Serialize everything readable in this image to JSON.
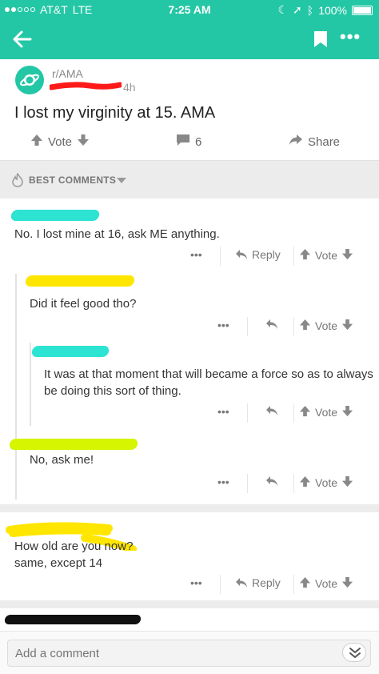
{
  "status_bar": {
    "carrier": "AT&T",
    "network": "LTE",
    "time": "7:25 AM",
    "battery": "100%"
  },
  "app_bar": {
    "back_icon": "arrow-left-icon",
    "bookmark_icon": "bookmark-icon",
    "more_label": "•••"
  },
  "post": {
    "subreddit": "r/AMA",
    "age": "4h",
    "title": "I lost my virginity at 15. AMA",
    "vote_label": "Vote",
    "comment_count": "6",
    "share_label": "Share"
  },
  "sort": {
    "label": "BEST COMMENTS"
  },
  "comments": [
    {
      "text": "No. I lost mine at 16, ask ME anything.",
      "more": "•••",
      "reply": "Reply",
      "vote": "Vote"
    },
    {
      "text": "Did it feel good tho?",
      "more": "•••",
      "vote": "Vote"
    },
    {
      "text": "It was at that moment that will became a force so as to always be doing this sort of thing.",
      "more": "•••",
      "vote": "Vote"
    },
    {
      "text": "No, ask me!",
      "more": "•••",
      "vote": "Vote"
    },
    {
      "text": "How old are you now?\nsame, except 14",
      "more": "•••",
      "reply": "Reply",
      "vote": "Vote"
    }
  ],
  "composer": {
    "placeholder": "Add a comment"
  },
  "colors": {
    "accent": "#24c7a5",
    "redaction_cyan": "#2de3d2",
    "redaction_yellow": "#ffe600",
    "redaction_lime": "#d5f500",
    "redaction_red": "#ff1a1a"
  }
}
